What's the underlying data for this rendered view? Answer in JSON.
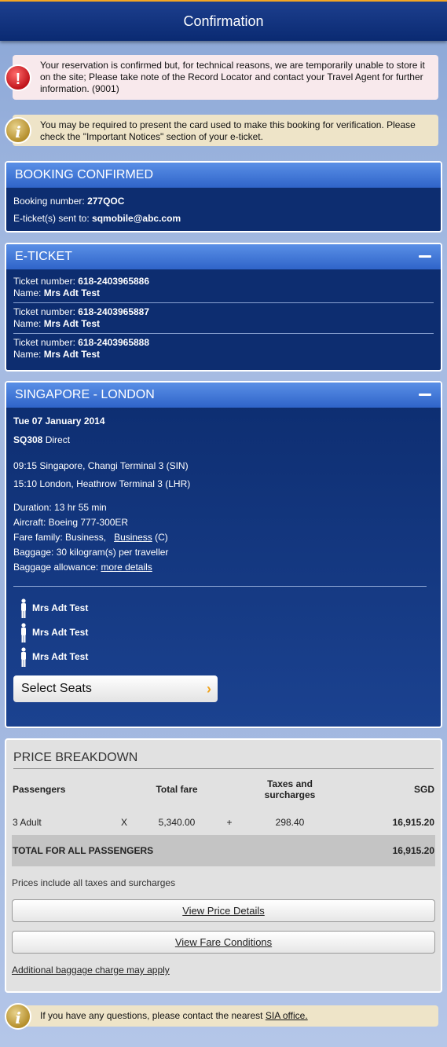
{
  "header": {
    "title": "Confirmation"
  },
  "alerts": {
    "error_text": "Your reservation is confirmed but, for technical reasons, we are temporarily unable to store it on the site; Please take note of the Record Locator and contact your Travel Agent for further information. (9001)",
    "info_text": "You may be required to present the card used to make this booking for verification. Please check the \"Important Notices\" section of your e-ticket.",
    "footer_text": "If you have any questions, please contact the nearest ",
    "footer_link": "SIA office."
  },
  "booking": {
    "title": "BOOKING CONFIRMED",
    "number_label": "Booking number:",
    "number": "277QOC",
    "sent_label": "E-ticket(s) sent to:",
    "email": "sqmobile@abc.com"
  },
  "eticket": {
    "title": "E-TICKET",
    "ticket_label": "Ticket number:",
    "name_label": "Name:",
    "tickets": [
      {
        "number": "618-2403965886",
        "name": "Mrs Adt Test"
      },
      {
        "number": "618-2403965887",
        "name": "Mrs Adt Test"
      },
      {
        "number": "618-2403965888",
        "name": "Mrs Adt Test"
      }
    ]
  },
  "flight": {
    "title": "SINGAPORE - LONDON",
    "date": "Tue 07 January 2014",
    "flight_no": "SQ308",
    "type": "Direct",
    "depart": "09:15 Singapore, Changi Terminal 3 (SIN)",
    "arrive": "15:10 London, Heathrow Terminal 3 (LHR)",
    "duration": "Duration: 13 hr 55 min",
    "aircraft": "Aircraft: Boeing 777-300ER",
    "fare_family_label": "Fare family: Business,",
    "fare_family_link": "Business",
    "fare_class": "(C)",
    "baggage": "Baggage: 30 kilogram(s) per traveller",
    "allowance_label": "Baggage allowance:",
    "allowance_link": "more details",
    "passengers": [
      "Mrs Adt Test",
      "Mrs Adt Test",
      "Mrs Adt Test"
    ],
    "select_seats": "Select Seats"
  },
  "price": {
    "title": "PRICE BREAKDOWN",
    "headers": {
      "passengers": "Passengers",
      "total_fare": "Total fare",
      "taxes": "Taxes and surcharges",
      "currency": "SGD"
    },
    "row": {
      "pax": "3 Adult",
      "x": "X",
      "fare": "5,340.00",
      "plus": "+",
      "taxes": "298.40",
      "total": "16,915.20"
    },
    "total_label": "TOTAL FOR ALL PASSENGERS",
    "total_value": "16,915.20",
    "note": "Prices include all taxes and surcharges",
    "view_details": "View Price Details",
    "view_conditions": "View Fare Conditions",
    "baggage_link": "Additional baggage charge may apply"
  }
}
